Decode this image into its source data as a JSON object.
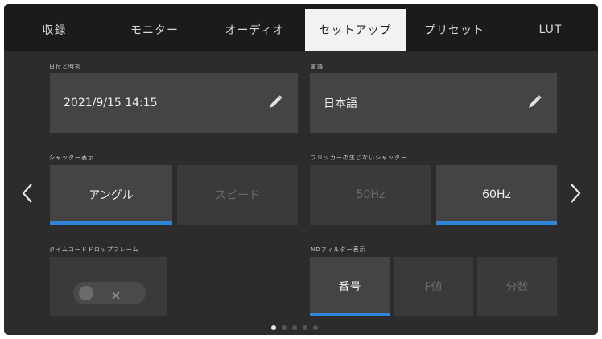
{
  "tabs": [
    {
      "label": "収録"
    },
    {
      "label": "モニター"
    },
    {
      "label": "オーディオ"
    },
    {
      "label": "セットアップ",
      "active": true
    },
    {
      "label": "プリセット"
    },
    {
      "label": "LUT"
    }
  ],
  "date_time": {
    "label": "日付と時刻",
    "value": "2021/9/15  14:15"
  },
  "language": {
    "label": "言語",
    "value": "日本語"
  },
  "shutter_display": {
    "label": "シャッター表示",
    "options": [
      "アングル",
      "スピード"
    ],
    "selected": "アングル"
  },
  "flicker_free_shutter": {
    "label": "フリッカーの生じないシャッター",
    "options": [
      "50Hz",
      "60Hz"
    ],
    "selected": "60Hz"
  },
  "timecode_drop_frame": {
    "label": "タイムコードドロップフレーム",
    "state": "off"
  },
  "nd_filter_display": {
    "label": "NDフィルター表示",
    "options": [
      "番号",
      "F値",
      "分数"
    ],
    "selected": "番号"
  },
  "page_indicator": {
    "current": 1,
    "total": 5
  },
  "colors": {
    "accent": "#2f86d9",
    "background": "#2c2c2c",
    "tabbar": "#1b1b1b",
    "active_tab": "#f2f2f2"
  },
  "icons": {
    "edit": "pencil-icon",
    "prev": "chevron-left-icon",
    "next": "chevron-right-icon",
    "off": "x-icon"
  }
}
